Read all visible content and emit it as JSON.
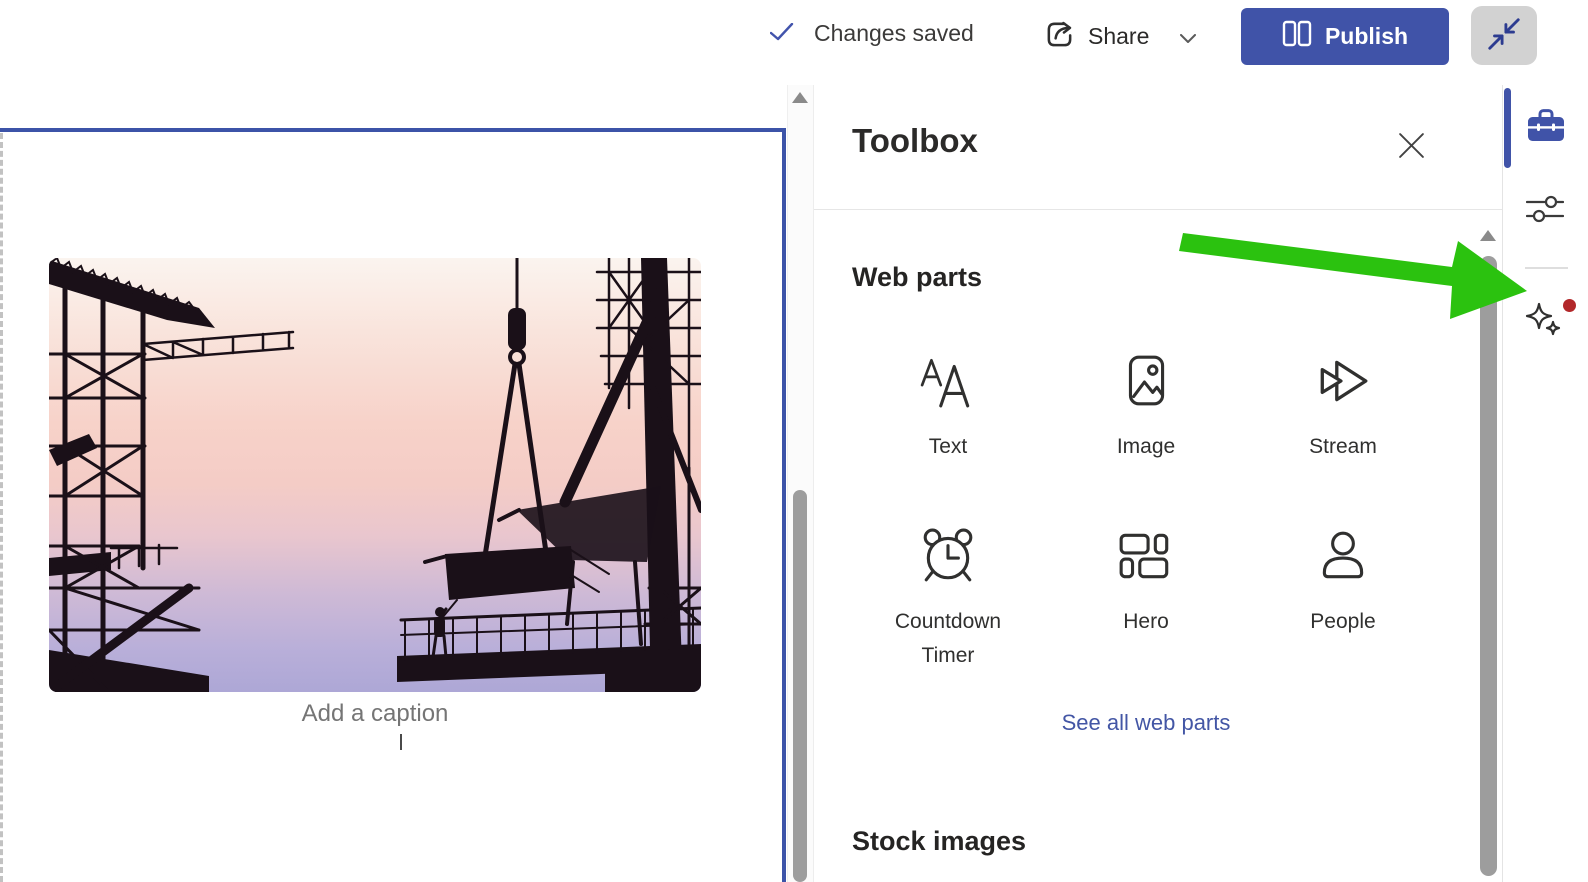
{
  "top_bar": {
    "changes_saved": "Changes saved",
    "share": "Share",
    "publish": "Publish"
  },
  "canvas": {
    "caption_placeholder": "Add a caption"
  },
  "toolbox": {
    "title": "Toolbox",
    "web_parts_heading": "Web parts",
    "see_all_link": "See all web parts",
    "stock_images_heading": "Stock images",
    "web_parts": [
      {
        "label": "Text",
        "icon": "text-icon"
      },
      {
        "label": "Image",
        "icon": "image-icon"
      },
      {
        "label": "Stream",
        "icon": "stream-icon"
      },
      {
        "label": "Countdown Timer",
        "icon": "countdown-timer-icon"
      },
      {
        "label": "Hero",
        "icon": "hero-icon"
      },
      {
        "label": "People",
        "icon": "people-icon"
      }
    ]
  },
  "colors": {
    "accent_blue": "#4053A8",
    "selection_border_blue": "#3C53A8",
    "annotation_green": "#2BC20F",
    "notification_red": "#B2282A",
    "link_blue": "#4356A5"
  }
}
